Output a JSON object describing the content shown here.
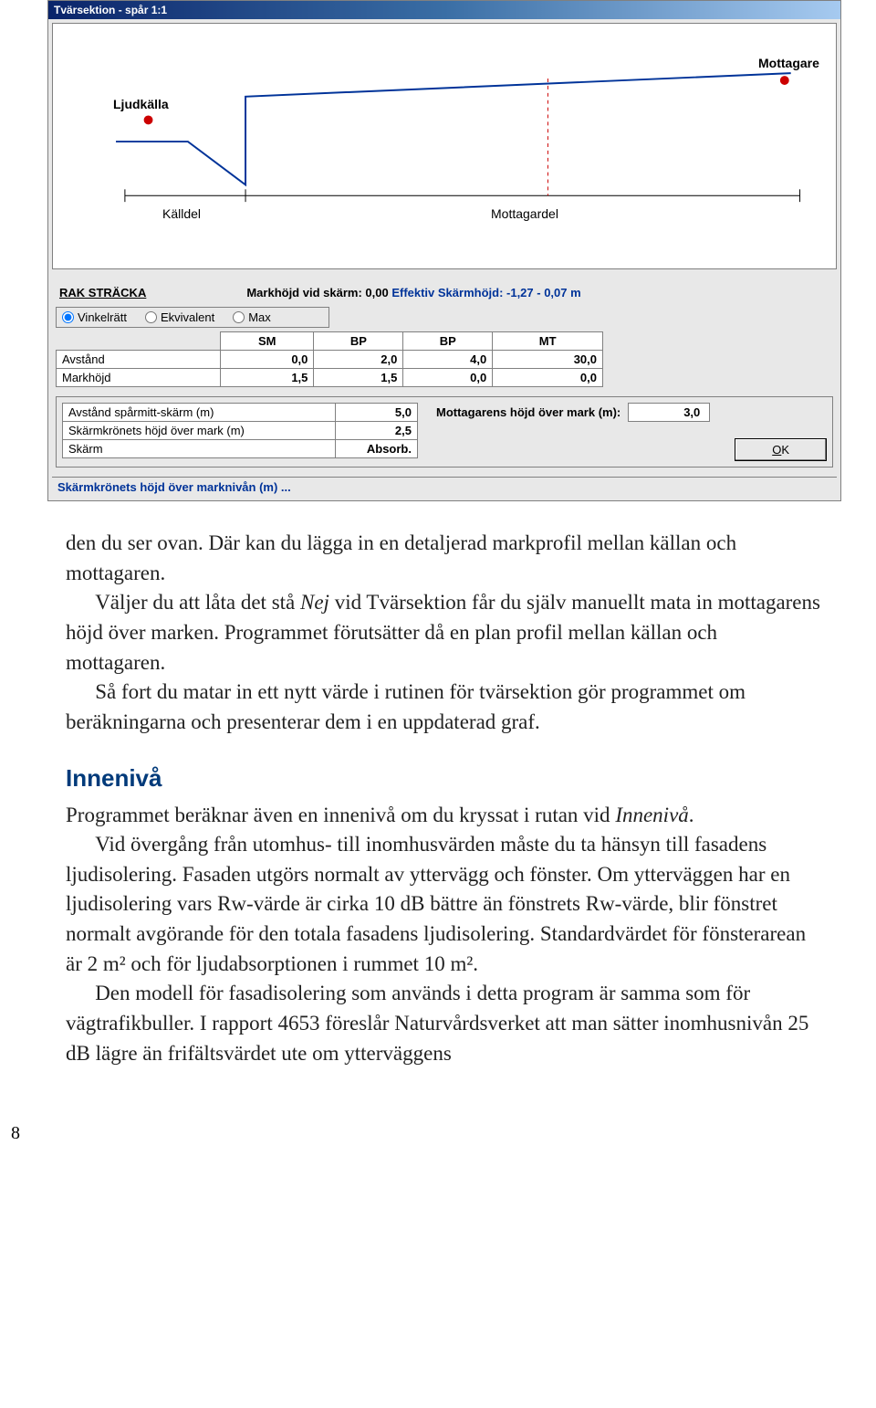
{
  "dialog": {
    "title": "Tvärsektion - spår 1:1",
    "graph": {
      "ljudkalla": "Ljudkälla",
      "mottagare": "Mottagare",
      "kalldel": "Källdel",
      "mottagardel": "Mottagardel"
    },
    "rak_label": "RAK STRÄCKA",
    "markhojd_line": "Markhöjd vid skärm: 0,00",
    "eff_label": "Effektiv Skärmhöjd: -1,27 - 0,07 m",
    "radios": {
      "vinkelratt": "Vinkelrätt",
      "ekvivalent": "Ekvivalent",
      "max": "Max"
    },
    "table": {
      "headers": [
        "SM",
        "BP",
        "BP",
        "MT"
      ],
      "rows": [
        {
          "name": "Avstånd",
          "vals": [
            "0,0",
            "2,0",
            "4,0",
            "30,0"
          ]
        },
        {
          "name": "Markhöjd",
          "vals": [
            "1,5",
            "1,5",
            "0,0",
            "0,0"
          ]
        }
      ]
    },
    "params": [
      {
        "label": "Avstånd spårmitt-skärm (m)",
        "val": "5,0"
      },
      {
        "label": "Skärmkrönets höjd över mark (m)",
        "val": "2,5"
      },
      {
        "label": "Skärm",
        "val": "Absorb."
      }
    ],
    "right": {
      "label": "Mottagarens höjd över mark (m):",
      "val": "3,0",
      "ok": "OK"
    },
    "status": "Skärmkrönets höjd över marknivån (m) ..."
  },
  "article": {
    "p1": "den du ser ovan. Där kan du lägga in en detaljerad markprofil mellan källan och mottagaren.",
    "p2a": "Väljer du att låta det stå ",
    "p2i": "Nej",
    "p2b": " vid Tvärsektion får du själv manuellt mata in mottagarens höjd över marken. Programmet förutsätter då en plan profil mellan källan och mottagaren.",
    "p3": "Så fort du matar in ett nytt värde i rutinen för tvärsektion gör programmet om beräkningarna och presenterar dem i en uppdaterad graf.",
    "h3": "Innenivå",
    "p4a": "Programmet beräknar även en innenivå om du kryssat i rutan vid ",
    "p4i": "Innenivå",
    "p4b": ".",
    "p5": "Vid övergång från utomhus- till inomhusvärden måste du ta hänsyn till fasadens ljudisolering. Fasaden utgörs normalt av yttervägg och fönster. Om ytterväggen har en ljudisolering vars Rw-värde är cirka 10 dB bättre än fönstrets Rw-värde, blir fönstret normalt avgörande för den totala fasadens ljudisolering. Standardvärdet för fönsterarean är 2 m² och för ljudabsorptionen i rummet 10 m².",
    "p6": "Den modell för fasadisolering som används i detta program är samma som för vägtrafikbuller. I rapport 4653 föreslår Naturvårdsverket att man sätter inomhusnivån 25 dB lägre än frifältsvärdet ute om ytterväggens"
  },
  "pagenum": "8"
}
